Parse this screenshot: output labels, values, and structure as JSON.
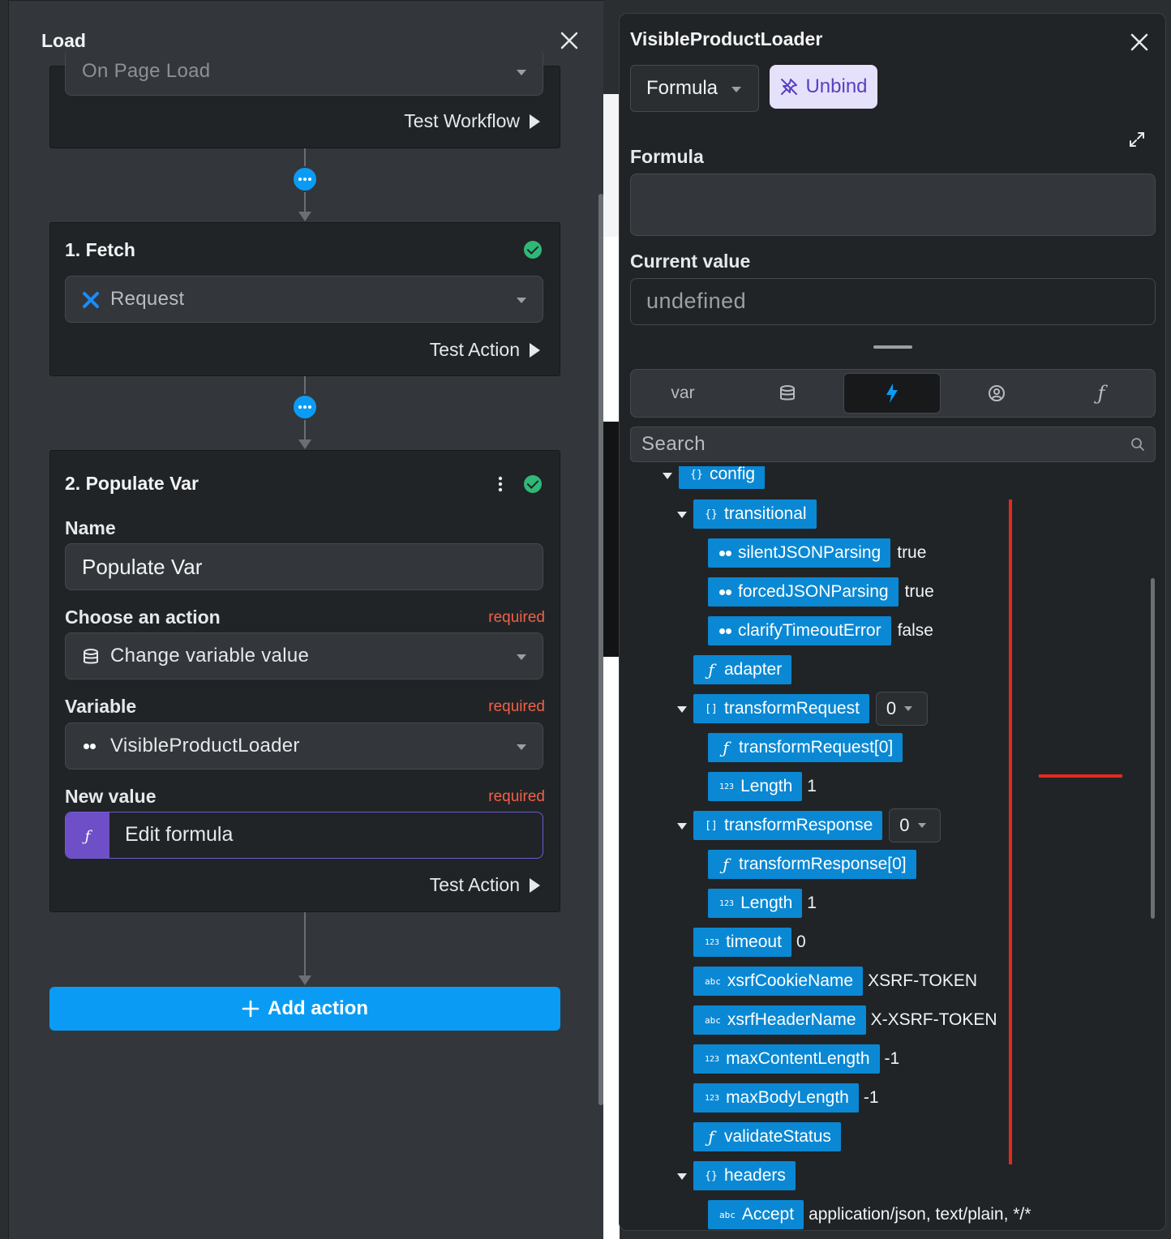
{
  "left_panel": {
    "title": "Load",
    "trigger": {
      "selected": "On Page Load",
      "test_label": "Test Workflow"
    },
    "fetch": {
      "title": "1. Fetch",
      "request_selected": "Request",
      "test_label": "Test Action"
    },
    "populate": {
      "title": "2. Populate Var",
      "name_label": "Name",
      "name_value": "Populate Var",
      "action_label": "Choose an action",
      "action_required": "required",
      "action_selected": "Change variable value",
      "variable_label": "Variable",
      "variable_required": "required",
      "variable_selected": "VisibleProductLoader",
      "newvalue_label": "New value",
      "newvalue_required": "required",
      "newvalue_text": "Edit formula",
      "test_label": "Test Action"
    },
    "add_action_label": "Add action"
  },
  "right_panel": {
    "title": "VisibleProductLoader",
    "mode_selected": "Formula",
    "unbind_label": "Unbind",
    "formula_label": "Formula",
    "formula_value": "",
    "current_value_label": "Current value",
    "current_value": "undefined",
    "tabs": [
      {
        "label": "var",
        "icon": "text"
      },
      {
        "label": "",
        "icon": "database-icon"
      },
      {
        "label": "",
        "icon": "lightning-icon"
      },
      {
        "label": "",
        "icon": "user-circle-icon"
      },
      {
        "label": "",
        "icon": "function-icon"
      }
    ],
    "active_tab": 2,
    "search_placeholder": "Search",
    "tree": {
      "config": "config",
      "transitional": "transitional",
      "silentJSONParsing": "silentJSONParsing",
      "silentJSONParsing_val": "true",
      "forcedJSONParsing": "forcedJSONParsing",
      "forcedJSONParsing_val": "true",
      "clarifyTimeoutError": "clarifyTimeoutError",
      "clarifyTimeoutError_val": "false",
      "adapter": "adapter",
      "transformRequest": "transformRequest",
      "transformRequest_idx": "0",
      "transformRequest0": "transformRequest[0]",
      "length1": "Length",
      "length1_val": "1",
      "transformResponse": "transformResponse",
      "transformResponse_idx": "0",
      "transformResponse0": "transformResponse[0]",
      "length2": "Length",
      "length2_val": "1",
      "timeout": "timeout",
      "timeout_val": "0",
      "xsrfCookieName": "xsrfCookieName",
      "xsrfCookieName_val": "XSRF-TOKEN",
      "xsrfHeaderName": "xsrfHeaderName",
      "xsrfHeaderName_val": "X-XSRF-TOKEN",
      "maxContentLength": "maxContentLength",
      "maxContentLength_val": "-1",
      "maxBodyLength": "maxBodyLength",
      "maxBodyLength_val": "-1",
      "validateStatus": "validateStatus",
      "headers": "headers",
      "accept": "Accept",
      "accept_val": "application/json, text/plain, */*"
    },
    "type_icons": {
      "object": "{}",
      "array": "[]",
      "number": "123",
      "string": "abc",
      "function": "f"
    }
  },
  "colors": {
    "accent_blue": "#0a9cf5",
    "pill_blue": "#0a88d4",
    "success_green": "#2fb877",
    "required_red": "#f0604a",
    "formula_purple": "#6e4fc7",
    "annotation_red": "#e42a1e"
  }
}
